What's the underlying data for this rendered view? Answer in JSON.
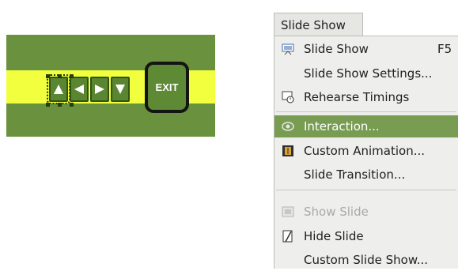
{
  "slide": {
    "exit_label": "EXIT",
    "nav_buttons": [
      "first-icon",
      "previous-icon",
      "next-icon",
      "last-icon"
    ],
    "colors": {
      "background": "#6a913e",
      "band": "#f2ff3f",
      "button": "#5a8631",
      "exit_border": "#141414"
    }
  },
  "menu": {
    "title": "Slide Show",
    "items": [
      {
        "label": "Slide Show",
        "accel": "F5",
        "icon": "slideshow-icon"
      },
      {
        "label": "Slide Show Settings..."
      },
      {
        "label": "Rehearse Timings",
        "icon": "stopwatch-icon"
      },
      {
        "label": "Interaction...",
        "icon": "interaction-icon",
        "highlighted": true
      },
      {
        "label": "Custom Animation...",
        "icon": "animation-icon"
      },
      {
        "label": "Slide Transition..."
      },
      {
        "label": "Show Slide",
        "icon": "show-slide-icon",
        "disabled": true
      },
      {
        "label": "Hide Slide",
        "icon": "hide-slide-icon"
      },
      {
        "label": "Custom Slide Show..."
      }
    ],
    "colors": {
      "highlight": "#779c52",
      "panel": "#eeeeec",
      "disabled_text": "#a9a9a6"
    }
  }
}
